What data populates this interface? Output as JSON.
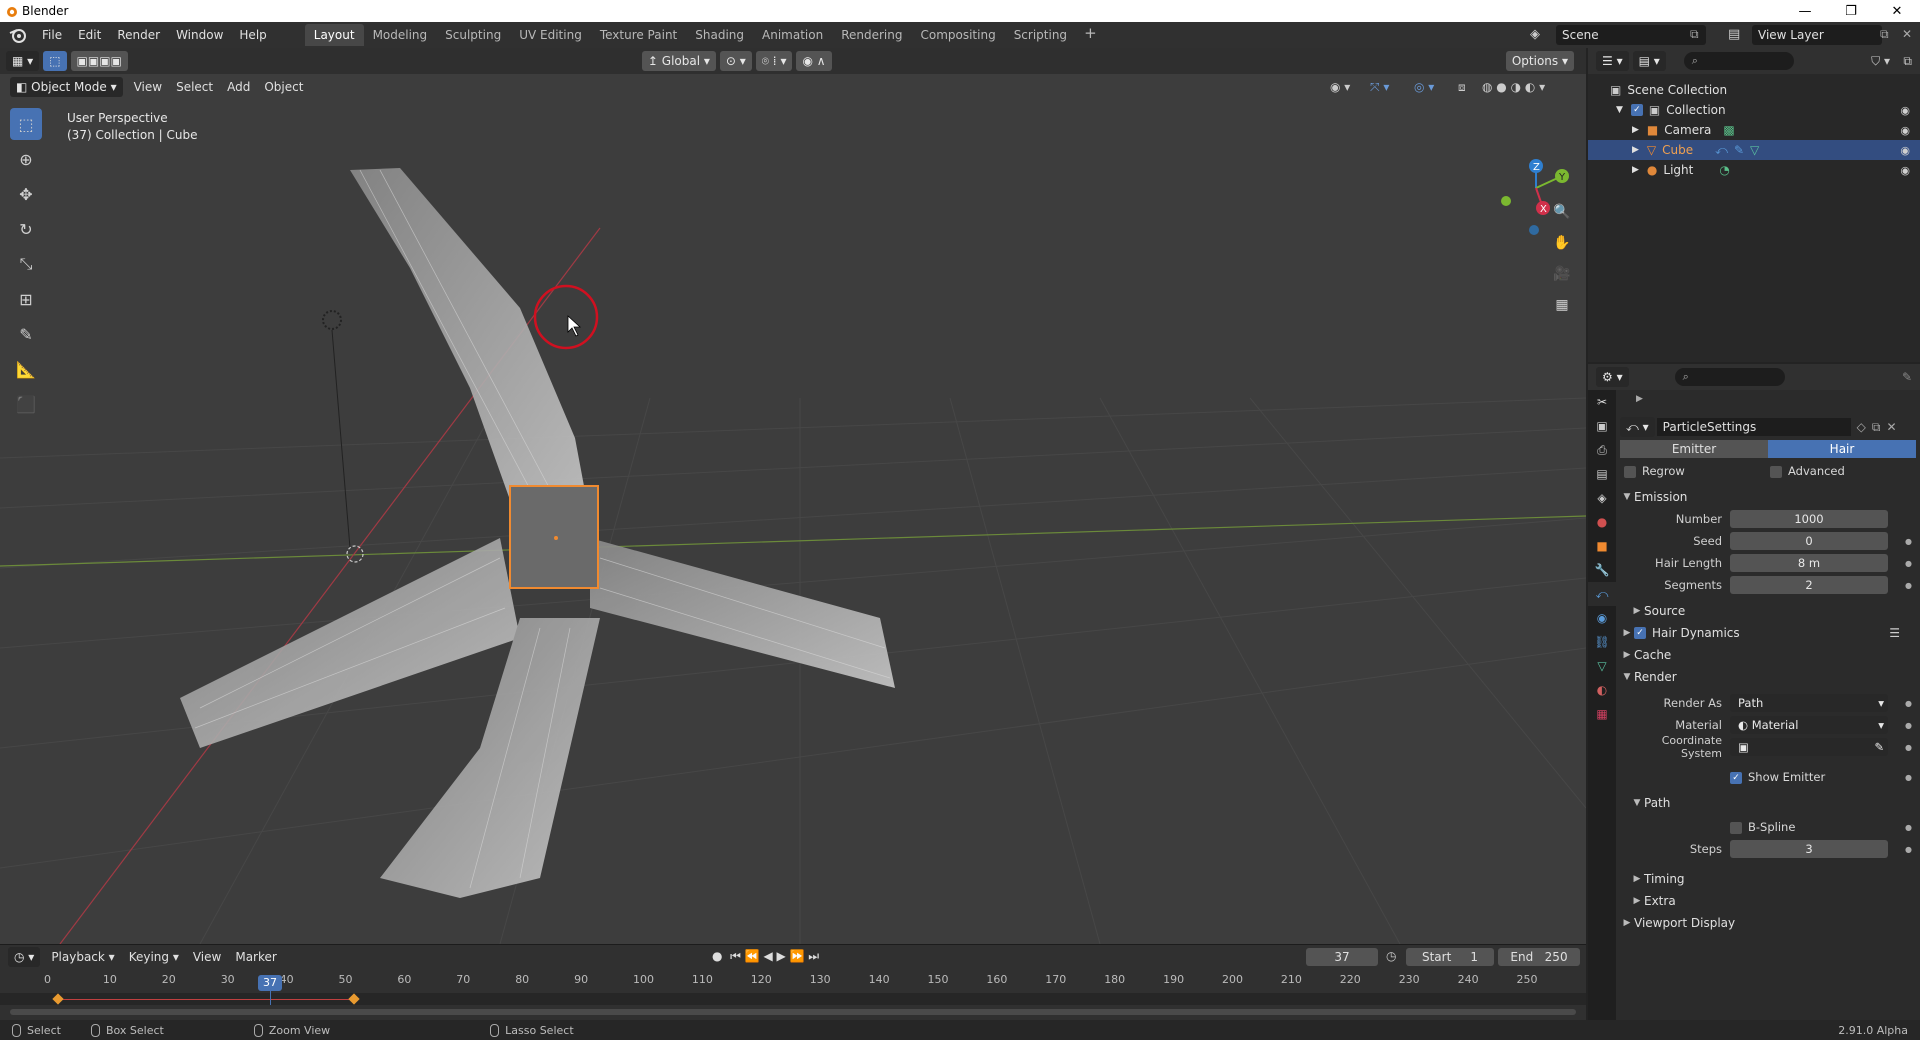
{
  "window": {
    "title": "Blender",
    "btn_min": "—",
    "btn_max": "❐",
    "btn_close": "✕"
  },
  "menu": [
    "File",
    "Edit",
    "Render",
    "Window",
    "Help"
  ],
  "workspaces": [
    "Layout",
    "Modeling",
    "Sculpting",
    "UV Editing",
    "Texture Paint",
    "Shading",
    "Animation",
    "Rendering",
    "Compositing",
    "Scripting"
  ],
  "active_workspace": "Layout",
  "scene": {
    "scene_name": "Scene",
    "view_layer": "View Layer"
  },
  "viewport": {
    "mode": "Object Mode",
    "menus": [
      "View",
      "Select",
      "Add",
      "Object"
    ],
    "orientation": "Global",
    "options_label": "Options",
    "info_line1": "User Perspective",
    "info_line2": "(37) Collection | Cube",
    "gizmo": {
      "z": "Z",
      "y": "Y",
      "x": "X"
    }
  },
  "timeline": {
    "menus": [
      "Playback",
      "Keying",
      "View",
      "Marker"
    ],
    "current_frame": "37",
    "start_label": "Start",
    "start": "1",
    "end_label": "End",
    "end": "250",
    "ticks": [
      "0",
      "10",
      "20",
      "30",
      "40",
      "50",
      "60",
      "70",
      "80",
      "90",
      "100",
      "110",
      "120",
      "130",
      "140",
      "150",
      "160",
      "170",
      "180",
      "190",
      "200",
      "210",
      "220",
      "230",
      "240",
      "250"
    ]
  },
  "status": {
    "select": "Select",
    "box_select": "Box Select",
    "zoom_view": "Zoom View",
    "lasso_select": "Lasso Select",
    "version": "2.91.0 Alpha"
  },
  "outliner": {
    "root": "Scene Collection",
    "collection": "Collection",
    "items": [
      "Camera",
      "Cube",
      "Light"
    ],
    "selected": "Cube"
  },
  "properties": {
    "datablock": "ParticleSettings",
    "type_tabs": [
      "Emitter",
      "Hair"
    ],
    "active_type": "Hair",
    "regrow": "Regrow",
    "advanced": "Advanced",
    "emission": {
      "title": "Emission",
      "number_label": "Number",
      "number": "1000",
      "seed_label": "Seed",
      "seed": "0",
      "hair_length_label": "Hair Length",
      "hair_length": "8 m",
      "segments_label": "Segments",
      "segments": "2"
    },
    "source": "Source",
    "hair_dynamics": "Hair Dynamics",
    "cache": "Cache",
    "render": {
      "title": "Render",
      "render_as_label": "Render As",
      "render_as": "Path",
      "material_label": "Material",
      "material": "Material",
      "coord_label": "Coordinate System",
      "show_emitter": "Show Emitter",
      "path": "Path",
      "bspline": "B-Spline",
      "steps_label": "Steps",
      "steps": "3"
    },
    "timing": "Timing",
    "extra": "Extra",
    "viewport_display": "Viewport Display"
  },
  "colors": {
    "accent": "#4772b3",
    "selection_outline": "#f08a30",
    "cursor_ring": "#d01020"
  }
}
